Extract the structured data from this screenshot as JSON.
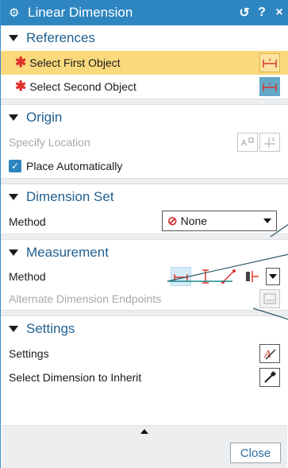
{
  "dialog": {
    "title": "Linear Dimension",
    "reset_icon": "reset-icon",
    "help_label": "?",
    "close_label": "×"
  },
  "references": {
    "header": "References",
    "first_object": "Select First Object",
    "second_object": "Select Second Object",
    "required_mark": "✱"
  },
  "origin": {
    "header": "Origin",
    "specify_location": "Specify Location",
    "place_automatically": "Place Automatically",
    "place_automatically_checked": true
  },
  "dimension_set": {
    "header": "Dimension Set",
    "method_label": "Method",
    "method_value": "None"
  },
  "measurement": {
    "header": "Measurement",
    "method_label": "Method",
    "alternate_endpoints": "Alternate Dimension Endpoints"
  },
  "settings": {
    "header": "Settings",
    "settings_label": "Settings",
    "inherit_label": "Select Dimension to Inherit"
  },
  "footer": {
    "close_button": "Close"
  },
  "colors": {
    "titlebar": "#2e86c1",
    "selected_row": "#fad97c",
    "section_text": "#1f5f8f",
    "required": "#e0302a"
  }
}
